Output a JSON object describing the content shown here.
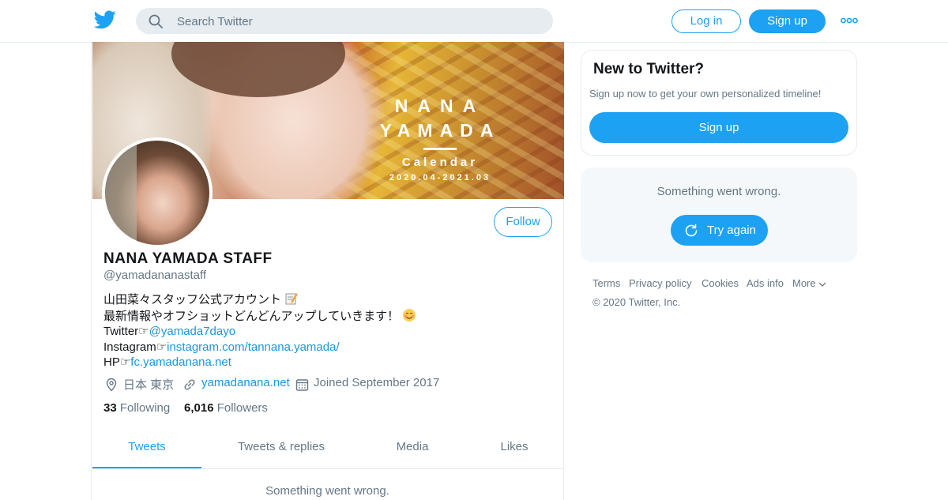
{
  "header": {
    "search_placeholder": "Search Twitter",
    "login_label": "Log in",
    "signup_label": "Sign up"
  },
  "banner": {
    "line1": "NANA",
    "line2": "YAMADA",
    "line3": "Calendar",
    "line4": "2020.04-2021.03"
  },
  "profile": {
    "name": "NANA YAMADA STAFF",
    "handle": "@yamadananastaff",
    "follow_label": "Follow",
    "bio": {
      "line1": "山田菜々スタッフ公式アカウント",
      "line2": " 最新情報やオフショットどんどんアップしていきます！",
      "twitter_prefix": "Twitter☞",
      "twitter_link": "@yamada7dayo",
      "instagram_prefix": "Instagram☞",
      "instagram_link": "instagram.com/tannana.yamada/",
      "hp_prefix": "HP☞",
      "hp_link": "fc.yamadanana.net"
    },
    "location": "日本 東京",
    "website": "yamadanana.net",
    "joined": "Joined September 2017",
    "following_count": "33",
    "following_label": "Following",
    "followers_count": "6,016",
    "followers_label": "Followers"
  },
  "tabs": [
    "Tweets",
    "Tweets & replies",
    "Media",
    "Likes"
  ],
  "timeline": {
    "error": "Something went wrong."
  },
  "sidebar": {
    "new_title": "New to Twitter?",
    "new_sub": "Sign up now to get your own personalized timeline!",
    "new_signup": "Sign up",
    "error_msg": "Something went wrong.",
    "retry_label": "Try again"
  },
  "footer": {
    "links": [
      "Terms",
      "Privacy policy",
      "Cookies",
      "Ads info",
      "More"
    ],
    "copyright": "© 2020 Twitter, Inc."
  },
  "colors": {
    "brand": "#1da1f2",
    "link": "#1b95e0",
    "secondary_text": "#657786",
    "border": "#e6ecf0"
  },
  "icons": [
    "twitter-bird-icon",
    "search-icon",
    "more-dots-icon",
    "location-pin-icon",
    "link-icon",
    "calendar-icon",
    "refresh-icon",
    "chevron-down-icon",
    "memo-emoji-icon",
    "smiling-face-emoji-icon"
  ]
}
